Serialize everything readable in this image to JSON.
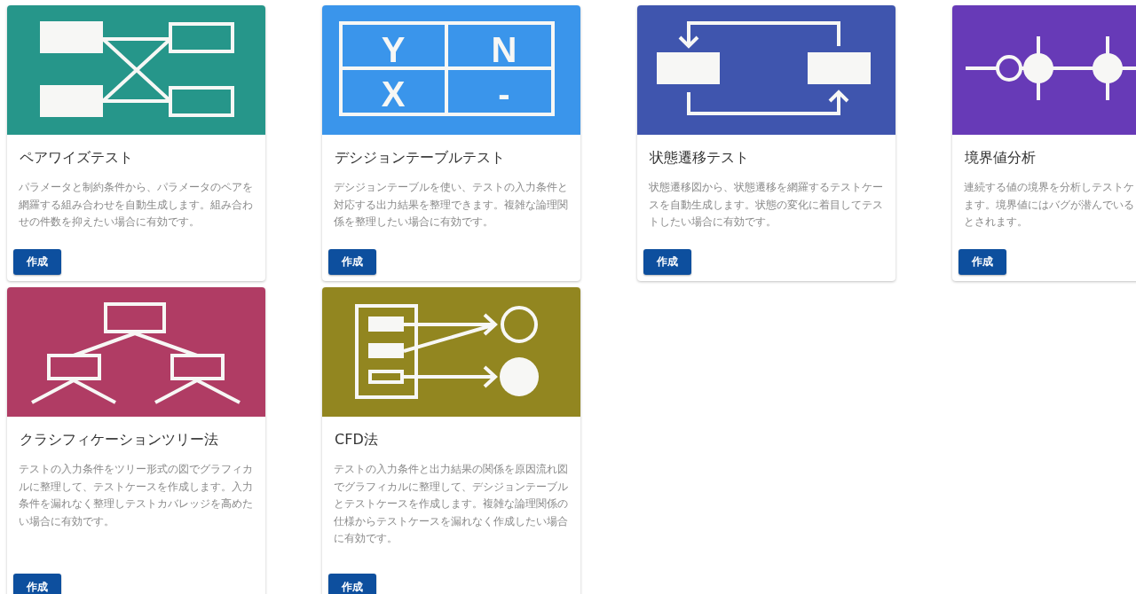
{
  "cards": [
    {
      "kind": "pairwise",
      "color": "#26968a",
      "title": "ペアワイズテスト",
      "description_lines": [
        "パラメータと制約条件から、パラメータのペアを",
        "網羅する組み合わせを自動生成します。組み合わ",
        "せの件数を抑えたい場合に有効です。"
      ],
      "button": "作成"
    },
    {
      "kind": "decision",
      "color": "#3a95eb",
      "title": "デシジョンテーブルテスト",
      "table_cells": [
        "Y",
        "N",
        "X",
        "-"
      ],
      "description_lines": [
        "デシジョンテーブルを使い、テストの入力条件と",
        "対応する出力結果を整理できます。複雑な論理関",
        "係を整理したい場合に有効です。"
      ],
      "button": "作成"
    },
    {
      "kind": "state",
      "color": "#3f55ae",
      "title": "状態遷移テスト",
      "description_lines": [
        "状態遷移図から、状態遷移を網羅するテストケー",
        "スを自動生成します。状態の変化に着目してテス",
        "トしたい場合に有効です。"
      ],
      "button": "作成"
    },
    {
      "kind": "boundary",
      "color": "#673ab7",
      "title": "境界値分析",
      "description_lines": [
        "連続する値の境界を分析しテストケ",
        "ます。境界値にはバグが潜んでいる",
        "とされます。"
      ],
      "button": "作成"
    },
    {
      "kind": "tree",
      "color": "#b03c64",
      "title": "クラシフィケーションツリー法",
      "description_lines": [
        "テストの入力条件をツリー形式の図でグラフィカ",
        "ルに整理して、テストケースを作成します。入力",
        "条件を漏れなく整理しテストカバレッジを高めた",
        "い場合に有効です。"
      ],
      "button": "作成"
    },
    {
      "kind": "cfd",
      "color": "#928620",
      "title": "CFD法",
      "description_lines": [
        "テストの入力条件と出力結果の関係を原因流れ図",
        "でグラフィカルに整理して、デシジョンテーブル",
        "とテストケースを作成します。複雑な論理関係の",
        "仕様からテストケースを漏れなく作成したい場合",
        "に有効です。"
      ],
      "button": "作成"
    }
  ]
}
